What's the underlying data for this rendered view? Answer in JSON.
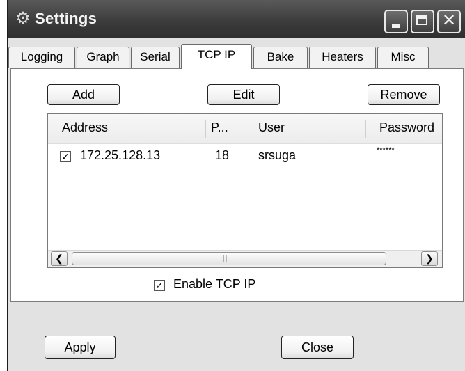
{
  "window": {
    "title": "Settings",
    "title_icon": "gear-icon",
    "controls": [
      "minimize-icon",
      "maximize-icon",
      "close-icon"
    ]
  },
  "tabs": [
    {
      "label": "Logging"
    },
    {
      "label": "Graph"
    },
    {
      "label": "Serial"
    },
    {
      "label": "TCP IP",
      "active": true
    },
    {
      "label": "Bake"
    },
    {
      "label": "Heaters"
    },
    {
      "label": "Misc"
    }
  ],
  "toolbar": {
    "add_label": "Add",
    "edit_label": "Edit",
    "remove_label": "Remove"
  },
  "table": {
    "columns": [
      "Address",
      "P...",
      "User",
      "Password"
    ],
    "rows": [
      {
        "checked": true,
        "address": "172.25.128.13",
        "port": "18",
        "user": "srsuga",
        "password": "******"
      }
    ]
  },
  "enable": {
    "label": "Enable TCP IP",
    "checked": true
  },
  "footer": {
    "apply_label": "Apply",
    "close_label": "Close"
  },
  "colors": {
    "titlebar": "#3c3c3c",
    "window_bg": "#e2e2e2",
    "panel_bg": "#ffffff"
  }
}
